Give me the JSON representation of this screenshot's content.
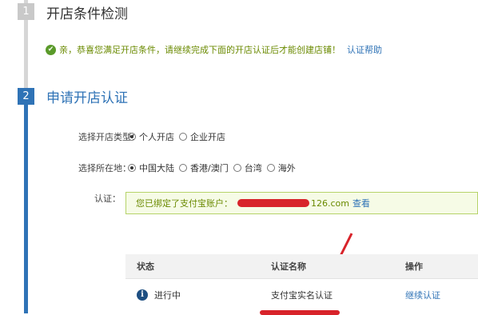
{
  "steps": {
    "one": {
      "number": "1",
      "title": "开店条件检测"
    },
    "two": {
      "number": "2",
      "title": "申请开店认证"
    }
  },
  "notice": {
    "text": "亲，恭喜您满足开店条件，请继续完成下面的开店认证后才能创建店铺！",
    "help_link": "认证帮助"
  },
  "shop_type": {
    "label": "选择开店类型：",
    "options": [
      "个人开店",
      "企业开店"
    ],
    "selected": "个人开店"
  },
  "location": {
    "label": "选择所在地：",
    "options": [
      "中国大陆",
      "香港/澳门",
      "台湾",
      "海外"
    ],
    "selected": "中国大陆"
  },
  "auth": {
    "label": "认证：",
    "bound_text": "您已绑定了支付宝账户：",
    "account_suffix": "126.com",
    "view_link": "查看"
  },
  "table": {
    "headers": [
      "状态",
      "认证名称",
      "操作"
    ],
    "rows": [
      {
        "status": "进行中",
        "name": "支付宝实名认证",
        "action": "继续认证"
      }
    ]
  },
  "colors": {
    "accent_blue": "#2f73b6",
    "success_green": "#6a8a00",
    "redaction_red": "#d8232a"
  }
}
